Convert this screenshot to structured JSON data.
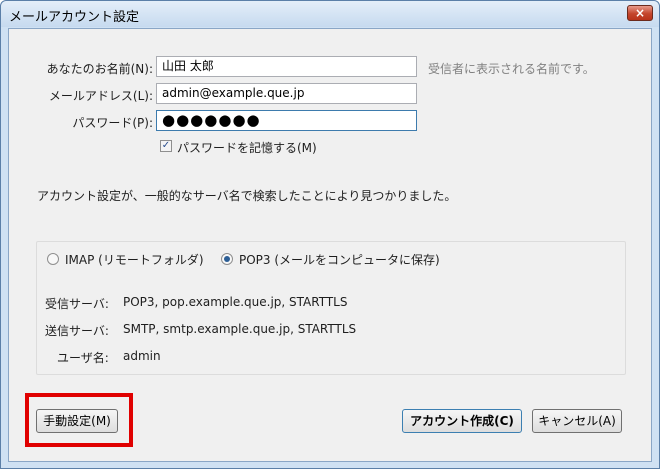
{
  "window": {
    "title": "メールアカウント設定",
    "close": "×"
  },
  "form": {
    "name_label": "あなたのお名前(N):",
    "name_value": "山田 太郎",
    "name_hint": "受信者に表示される名前です。",
    "email_label": "メールアドレス(L):",
    "email_value": "admin@example.que.jp",
    "password_label": "パスワード(P):",
    "password_value": "●●●●●●●",
    "remember_label": "パスワードを記憶する(M)",
    "remember_checked": true
  },
  "status_message": "アカウント設定が、一般的なサーバ名で検索したことにより見つかりました。",
  "protocol": {
    "imap_label": "IMAP (リモートフォルダ)",
    "pop3_label": "POP3 (メールをコンピュータに保存)",
    "selected": "POP3"
  },
  "details": {
    "incoming_label": "受信サーバ:",
    "incoming_value": "POP3, pop.example.que.jp, STARTTLS",
    "outgoing_label": "送信サーバ:",
    "outgoing_value": "SMTP, smtp.example.que.jp, STARTTLS",
    "username_label": "ユーザ名:",
    "username_value": "admin"
  },
  "buttons": {
    "manual": "手動設定(M)",
    "create": "アカウント作成(C)",
    "cancel": "キャンセル(A)"
  },
  "colors": {
    "highlight": "#e00000",
    "titlebar": "#c6daef"
  }
}
